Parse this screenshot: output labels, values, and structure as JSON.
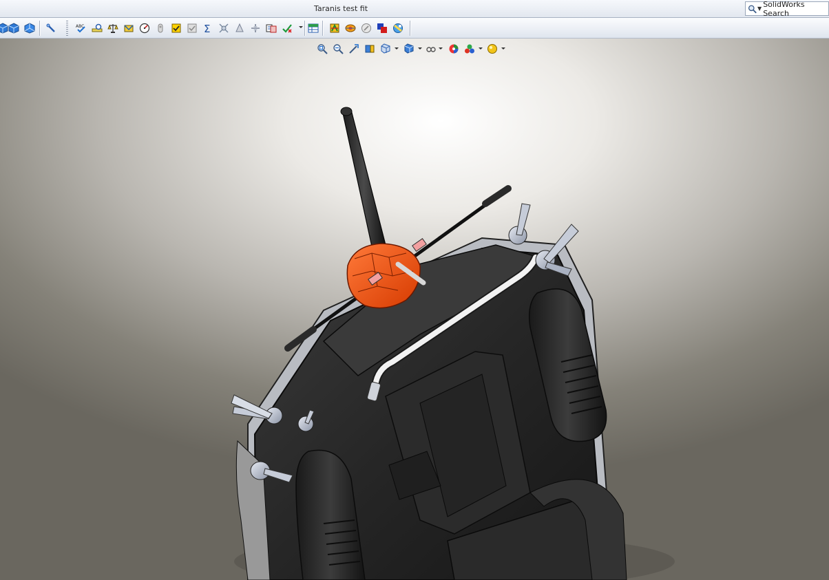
{
  "window": {
    "title": "Taranis test fit"
  },
  "search": {
    "label": "SolidWorks Search"
  },
  "toolbar": {
    "left_views": [
      {
        "name": "view-cube-1-icon"
      },
      {
        "name": "view-cube-2-icon"
      },
      {
        "name": "view-cube-3-icon"
      },
      {
        "name": "sketch-relations-icon"
      }
    ],
    "tools": [
      {
        "name": "spell-check-icon"
      },
      {
        "name": "measure-icon"
      },
      {
        "name": "mass-properties-icon"
      },
      {
        "name": "section-properties-icon"
      },
      {
        "name": "performance-evaluation-icon"
      },
      {
        "name": "check-icon"
      },
      {
        "name": "checklist-icon"
      },
      {
        "name": "checklist-gray-icon"
      },
      {
        "name": "equations-sum-icon"
      },
      {
        "name": "interference-icon"
      },
      {
        "name": "clearance-icon"
      },
      {
        "name": "hole-alignment-icon"
      },
      {
        "name": "compare-icon"
      },
      {
        "name": "import-diagnostics-icon"
      },
      {
        "name": "table-icon"
      },
      {
        "name": "dimxpert-icon"
      },
      {
        "name": "costing-icon"
      },
      {
        "name": "simulation-icon"
      },
      {
        "name": "color-squares-icon"
      },
      {
        "name": "render-icon"
      }
    ]
  },
  "heads_up": {
    "items": [
      {
        "name": "zoom-to-fit-icon"
      },
      {
        "name": "zoom-to-area-icon"
      },
      {
        "name": "previous-view-icon"
      },
      {
        "name": "section-view-icon"
      },
      {
        "name": "view-orientation-icon"
      },
      {
        "name": "display-style-icon"
      },
      {
        "name": "hide-show-items-icon"
      },
      {
        "name": "edit-appearance-icon"
      },
      {
        "name": "apply-scene-icon"
      },
      {
        "name": "view-settings-icon"
      }
    ]
  },
  "colors": {
    "orange_part": "#ff5a1a",
    "body": "#2e2e2e",
    "highlight": "#ffcc00"
  }
}
